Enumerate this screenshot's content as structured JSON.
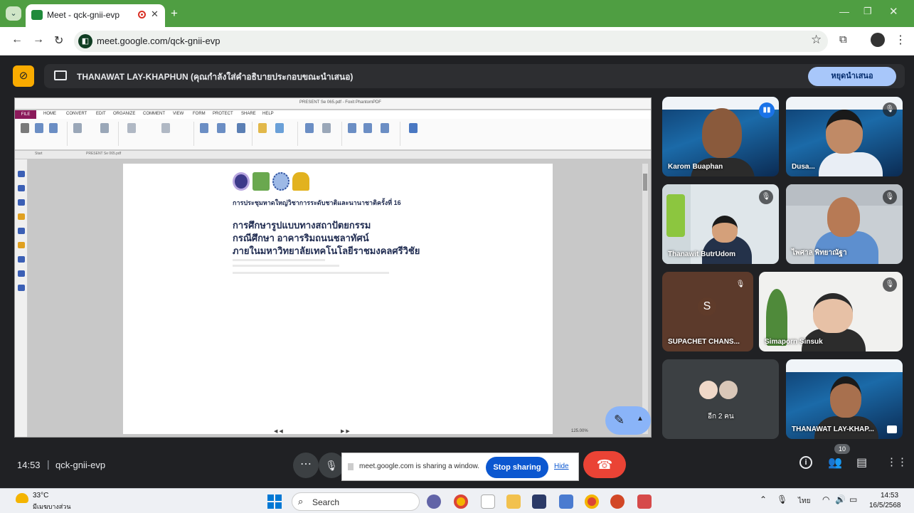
{
  "browser": {
    "tab_title": "Meet - qck-gnii-evp",
    "url": "meet.google.com/qck-gnii-evp",
    "new_tab_label": "+",
    "close_tab_label": "✕"
  },
  "presenter_bar": {
    "text": "THANAWAT LAY-KHAPHUN (คุณกำลังใส่คำอธิบายประกอบขณะนำเสนอ)",
    "stop_button": "หยุดนำเสนอ"
  },
  "shared_screen": {
    "app_title": "PRESENT Se 065.pdf - Foxit PhantomPDF",
    "ribbon_tabs": [
      "FILE",
      "HOME",
      "CONVERT",
      "EDIT",
      "ORGANIZE",
      "COMMENT",
      "VIEW",
      "FORM",
      "PROTECT",
      "SHARE",
      "HELP"
    ],
    "doc_tabs": [
      "Start",
      "PRESENT Se 065.pdf"
    ],
    "zoom": "125.00%",
    "slide": {
      "conference": "การประชุมหาดใหญ่วิชาการระดับชาติและนานาชาติครั้งที่ 16",
      "title_lines": [
        "การศึกษารูปแบบทางสถาปัตยกรรม",
        "กรณีศึกษา อาคารริมถนนชลาทัศน์",
        "ภายในมหาวิทยาลัยเทคโนโลยีราชมงคลศรีวิชัย"
      ]
    }
  },
  "participants": [
    {
      "name": "Karom Buaphan"
    },
    {
      "name": "Dusa..."
    },
    {
      "name": "Thanawit ButrUdom"
    },
    {
      "name": "ไพศาล พิทยาณัฐา"
    },
    {
      "name": "SUPACHET CHANS...",
      "initial": "S"
    },
    {
      "name": "Simaporn Sinsuk"
    },
    {
      "name": "อีก 2 คน"
    },
    {
      "name": "THANAWAT LAY-KHAP..."
    }
  ],
  "bottom_bar": {
    "time": "14:53",
    "separator": "|",
    "meeting_code": "qck-gnii-evp",
    "share_notice": "meet.google.com is sharing a window.",
    "stop_sharing": "Stop sharing",
    "hide": "Hide",
    "participant_count": "10"
  },
  "taskbar": {
    "temperature": "33°C",
    "weather": "มีเมฆบางส่วน",
    "search": "Search",
    "language": "ไทย",
    "clock_time": "14:53",
    "clock_date": "16/5/2568"
  },
  "colors": {
    "tab_bar": "#4f9e42",
    "meet_bg": "#202124",
    "accent_blue": "#0b57d0",
    "hangup_red": "#ea4335",
    "cam_off_yellow": "#f9ab00"
  }
}
